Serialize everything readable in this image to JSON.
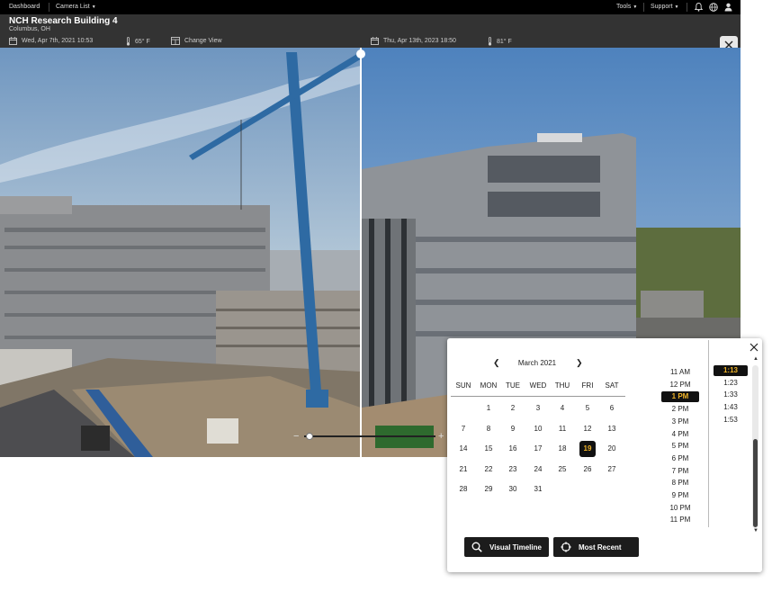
{
  "nav": {
    "dashboard": "Dashboard",
    "camera_list": "Camera List",
    "tools": "Tools",
    "support": "Support"
  },
  "camera": {
    "title": "NCH Research Building 4",
    "location": "Columbus, OH"
  },
  "left_view": {
    "datetime": "Wed, Apr 7th, 2021 10:53",
    "temperature": "65° F",
    "change_view": "Change View"
  },
  "right_view": {
    "datetime": "Thu, Apr 13th, 2023 18:50",
    "temperature": "81° F"
  },
  "calendar": {
    "month_label": "March 2021",
    "weekdays": [
      "SUN",
      "MON",
      "TUE",
      "WED",
      "THU",
      "FRI",
      "SAT"
    ],
    "weeks": [
      [
        "",
        "1",
        "2",
        "3",
        "4",
        "5",
        "6"
      ],
      [
        "7",
        "8",
        "9",
        "10",
        "11",
        "12",
        "13"
      ],
      [
        "14",
        "15",
        "16",
        "17",
        "18",
        "19",
        "20"
      ],
      [
        "21",
        "22",
        "23",
        "24",
        "25",
        "26",
        "27"
      ],
      [
        "28",
        "29",
        "30",
        "31",
        "",
        "",
        ""
      ]
    ],
    "selected_day": "19"
  },
  "hours": [
    "11 AM",
    "12 PM",
    "1 PM",
    "2 PM",
    "3 PM",
    "4 PM",
    "5 PM",
    "6 PM",
    "7 PM",
    "8 PM",
    "9 PM",
    "10 PM",
    "11 PM"
  ],
  "selected_hour": "1 PM",
  "minutes": [
    "1:13",
    "1:23",
    "1:33",
    "1:43",
    "1:53"
  ],
  "selected_minute": "1:13",
  "buttons": {
    "visual_timeline": "Visual Timeline",
    "most_recent": "Most Recent"
  },
  "colors": {
    "accent": "#f0b429",
    "nav_bg": "#000000",
    "header_bg": "#333333"
  }
}
